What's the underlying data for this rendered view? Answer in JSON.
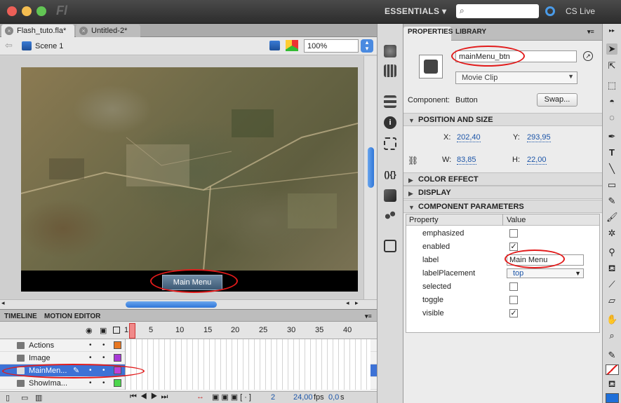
{
  "app": {
    "logo": "Fl",
    "workspace": "ESSENTIALS",
    "cs_live": "CS Live",
    "search_placeholder": ""
  },
  "tabs": [
    {
      "label": "Flash_tuto.fla*"
    },
    {
      "label": "Untitled-2*"
    }
  ],
  "edit_bar": {
    "scene": "Scene 1",
    "zoom": "100%"
  },
  "stage": {
    "button_label": "Main Menu"
  },
  "timeline": {
    "tab_timeline": "TIMELINE",
    "tab_motion": "MOTION EDITOR",
    "frame_numbers": [
      "1",
      "5",
      "10",
      "15",
      "20",
      "25",
      "30",
      "35",
      "40"
    ],
    "layers": [
      {
        "name": "Actions",
        "color": "#e87722"
      },
      {
        "name": "Image",
        "color": "#a83ad6"
      },
      {
        "name": "MainMen...",
        "color": "#c040d8"
      },
      {
        "name": "ShowIma...",
        "color": "#4dd64d"
      }
    ],
    "status": {
      "frame": "2",
      "fps": "24,00",
      "fps_unit": "fps",
      "time": "0,0",
      "time_unit": "s"
    }
  },
  "properties": {
    "tab_properties": "PROPERTIES",
    "tab_library": "LIBRARY",
    "instance_name": "mainMenu_btn",
    "symbol_type": "Movie Clip",
    "component_label": "Component:",
    "component_value": "Button",
    "swap_label": "Swap...",
    "sections": {
      "position": "POSITION AND SIZE",
      "color": "COLOR EFFECT",
      "display": "DISPLAY",
      "params": "COMPONENT PARAMETERS"
    },
    "x_label": "X:",
    "x": "202,40",
    "y_label": "Y:",
    "y": "293,95",
    "w_label": "W:",
    "w": "83,85",
    "h_label": "H:",
    "h": "22,00",
    "table_header": {
      "property": "Property",
      "value": "Value"
    },
    "params": [
      {
        "name": "emphasized",
        "checked": false
      },
      {
        "name": "enabled",
        "checked": true
      },
      {
        "name": "label",
        "text": "Main Menu"
      },
      {
        "name": "labelPlacement",
        "select": "top"
      },
      {
        "name": "selected",
        "checked": false
      },
      {
        "name": "toggle",
        "checked": false
      },
      {
        "name": "visible",
        "checked": true
      }
    ]
  },
  "colors": {
    "annotation": "#e21a1a",
    "link": "#1c55a8",
    "selection": "#3d72d6"
  }
}
